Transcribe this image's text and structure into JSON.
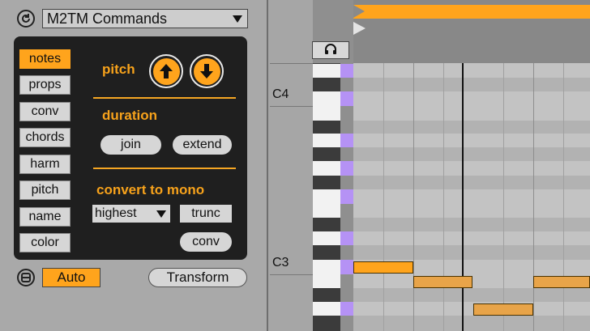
{
  "device": {
    "title": "M2TM Commands",
    "tabs": [
      "notes",
      "props",
      "conv",
      "chords",
      "harm",
      "pitch",
      "name",
      "color"
    ],
    "active_tab": "notes",
    "pitch_label": "pitch",
    "duration_label": "duration",
    "join_label": "join",
    "extend_label": "extend",
    "mono_label": "convert to mono",
    "mono_select_value": "highest",
    "trunc_label": "trunc",
    "conv_label": "conv",
    "auto_label": "Auto",
    "transform_label": "Transform"
  },
  "piano_roll": {
    "octave_labels": [
      "C4",
      "C3"
    ]
  },
  "colors": {
    "accent": "#ffa41c",
    "key_highlight": "#b592f5",
    "panel_bg": "#1f1f1f"
  },
  "icons": {
    "header": "refresh-icon",
    "footer": "hotswap-icon",
    "loop": "headphones-icon",
    "pitch_up": "arrow-up-icon",
    "pitch_down": "arrow-down-icon"
  }
}
